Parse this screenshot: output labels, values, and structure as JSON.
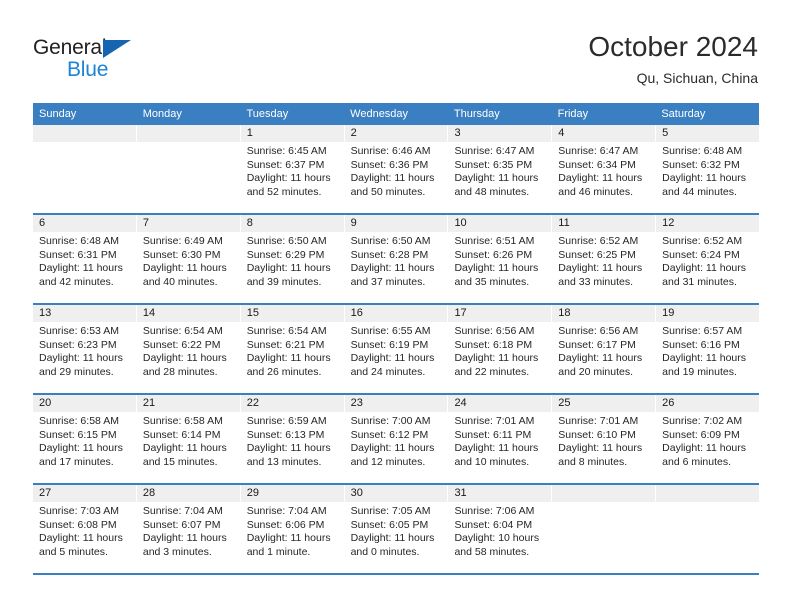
{
  "brand": {
    "name_top": "General",
    "name_bottom": "Blue",
    "triangle_color": "#1565b0",
    "blue_color": "#1b84d6"
  },
  "header": {
    "title": "October 2024",
    "subtitle": "Qu, Sichuan, China"
  },
  "theme": {
    "header_blue": "#3a7fc1",
    "day_number_bg": "#efefef"
  },
  "weekdays": [
    "Sunday",
    "Monday",
    "Tuesday",
    "Wednesday",
    "Thursday",
    "Friday",
    "Saturday"
  ],
  "weeks": [
    [
      {
        "day": "",
        "sunrise": "",
        "sunset": "",
        "daylight_line1": "",
        "daylight_line2": ""
      },
      {
        "day": "",
        "sunrise": "",
        "sunset": "",
        "daylight_line1": "",
        "daylight_line2": ""
      },
      {
        "day": "1",
        "sunrise": "Sunrise: 6:45 AM",
        "sunset": "Sunset: 6:37 PM",
        "daylight_line1": "Daylight: 11 hours",
        "daylight_line2": "and 52 minutes."
      },
      {
        "day": "2",
        "sunrise": "Sunrise: 6:46 AM",
        "sunset": "Sunset: 6:36 PM",
        "daylight_line1": "Daylight: 11 hours",
        "daylight_line2": "and 50 minutes."
      },
      {
        "day": "3",
        "sunrise": "Sunrise: 6:47 AM",
        "sunset": "Sunset: 6:35 PM",
        "daylight_line1": "Daylight: 11 hours",
        "daylight_line2": "and 48 minutes."
      },
      {
        "day": "4",
        "sunrise": "Sunrise: 6:47 AM",
        "sunset": "Sunset: 6:34 PM",
        "daylight_line1": "Daylight: 11 hours",
        "daylight_line2": "and 46 minutes."
      },
      {
        "day": "5",
        "sunrise": "Sunrise: 6:48 AM",
        "sunset": "Sunset: 6:32 PM",
        "daylight_line1": "Daylight: 11 hours",
        "daylight_line2": "and 44 minutes."
      }
    ],
    [
      {
        "day": "6",
        "sunrise": "Sunrise: 6:48 AM",
        "sunset": "Sunset: 6:31 PM",
        "daylight_line1": "Daylight: 11 hours",
        "daylight_line2": "and 42 minutes."
      },
      {
        "day": "7",
        "sunrise": "Sunrise: 6:49 AM",
        "sunset": "Sunset: 6:30 PM",
        "daylight_line1": "Daylight: 11 hours",
        "daylight_line2": "and 40 minutes."
      },
      {
        "day": "8",
        "sunrise": "Sunrise: 6:50 AM",
        "sunset": "Sunset: 6:29 PM",
        "daylight_line1": "Daylight: 11 hours",
        "daylight_line2": "and 39 minutes."
      },
      {
        "day": "9",
        "sunrise": "Sunrise: 6:50 AM",
        "sunset": "Sunset: 6:28 PM",
        "daylight_line1": "Daylight: 11 hours",
        "daylight_line2": "and 37 minutes."
      },
      {
        "day": "10",
        "sunrise": "Sunrise: 6:51 AM",
        "sunset": "Sunset: 6:26 PM",
        "daylight_line1": "Daylight: 11 hours",
        "daylight_line2": "and 35 minutes."
      },
      {
        "day": "11",
        "sunrise": "Sunrise: 6:52 AM",
        "sunset": "Sunset: 6:25 PM",
        "daylight_line1": "Daylight: 11 hours",
        "daylight_line2": "and 33 minutes."
      },
      {
        "day": "12",
        "sunrise": "Sunrise: 6:52 AM",
        "sunset": "Sunset: 6:24 PM",
        "daylight_line1": "Daylight: 11 hours",
        "daylight_line2": "and 31 minutes."
      }
    ],
    [
      {
        "day": "13",
        "sunrise": "Sunrise: 6:53 AM",
        "sunset": "Sunset: 6:23 PM",
        "daylight_line1": "Daylight: 11 hours",
        "daylight_line2": "and 29 minutes."
      },
      {
        "day": "14",
        "sunrise": "Sunrise: 6:54 AM",
        "sunset": "Sunset: 6:22 PM",
        "daylight_line1": "Daylight: 11 hours",
        "daylight_line2": "and 28 minutes."
      },
      {
        "day": "15",
        "sunrise": "Sunrise: 6:54 AM",
        "sunset": "Sunset: 6:21 PM",
        "daylight_line1": "Daylight: 11 hours",
        "daylight_line2": "and 26 minutes."
      },
      {
        "day": "16",
        "sunrise": "Sunrise: 6:55 AM",
        "sunset": "Sunset: 6:19 PM",
        "daylight_line1": "Daylight: 11 hours",
        "daylight_line2": "and 24 minutes."
      },
      {
        "day": "17",
        "sunrise": "Sunrise: 6:56 AM",
        "sunset": "Sunset: 6:18 PM",
        "daylight_line1": "Daylight: 11 hours",
        "daylight_line2": "and 22 minutes."
      },
      {
        "day": "18",
        "sunrise": "Sunrise: 6:56 AM",
        "sunset": "Sunset: 6:17 PM",
        "daylight_line1": "Daylight: 11 hours",
        "daylight_line2": "and 20 minutes."
      },
      {
        "day": "19",
        "sunrise": "Sunrise: 6:57 AM",
        "sunset": "Sunset: 6:16 PM",
        "daylight_line1": "Daylight: 11 hours",
        "daylight_line2": "and 19 minutes."
      }
    ],
    [
      {
        "day": "20",
        "sunrise": "Sunrise: 6:58 AM",
        "sunset": "Sunset: 6:15 PM",
        "daylight_line1": "Daylight: 11 hours",
        "daylight_line2": "and 17 minutes."
      },
      {
        "day": "21",
        "sunrise": "Sunrise: 6:58 AM",
        "sunset": "Sunset: 6:14 PM",
        "daylight_line1": "Daylight: 11 hours",
        "daylight_line2": "and 15 minutes."
      },
      {
        "day": "22",
        "sunrise": "Sunrise: 6:59 AM",
        "sunset": "Sunset: 6:13 PM",
        "daylight_line1": "Daylight: 11 hours",
        "daylight_line2": "and 13 minutes."
      },
      {
        "day": "23",
        "sunrise": "Sunrise: 7:00 AM",
        "sunset": "Sunset: 6:12 PM",
        "daylight_line1": "Daylight: 11 hours",
        "daylight_line2": "and 12 minutes."
      },
      {
        "day": "24",
        "sunrise": "Sunrise: 7:01 AM",
        "sunset": "Sunset: 6:11 PM",
        "daylight_line1": "Daylight: 11 hours",
        "daylight_line2": "and 10 minutes."
      },
      {
        "day": "25",
        "sunrise": "Sunrise: 7:01 AM",
        "sunset": "Sunset: 6:10 PM",
        "daylight_line1": "Daylight: 11 hours",
        "daylight_line2": "and 8 minutes."
      },
      {
        "day": "26",
        "sunrise": "Sunrise: 7:02 AM",
        "sunset": "Sunset: 6:09 PM",
        "daylight_line1": "Daylight: 11 hours",
        "daylight_line2": "and 6 minutes."
      }
    ],
    [
      {
        "day": "27",
        "sunrise": "Sunrise: 7:03 AM",
        "sunset": "Sunset: 6:08 PM",
        "daylight_line1": "Daylight: 11 hours",
        "daylight_line2": "and 5 minutes."
      },
      {
        "day": "28",
        "sunrise": "Sunrise: 7:04 AM",
        "sunset": "Sunset: 6:07 PM",
        "daylight_line1": "Daylight: 11 hours",
        "daylight_line2": "and 3 minutes."
      },
      {
        "day": "29",
        "sunrise": "Sunrise: 7:04 AM",
        "sunset": "Sunset: 6:06 PM",
        "daylight_line1": "Daylight: 11 hours",
        "daylight_line2": "and 1 minute."
      },
      {
        "day": "30",
        "sunrise": "Sunrise: 7:05 AM",
        "sunset": "Sunset: 6:05 PM",
        "daylight_line1": "Daylight: 11 hours",
        "daylight_line2": "and 0 minutes."
      },
      {
        "day": "31",
        "sunrise": "Sunrise: 7:06 AM",
        "sunset": "Sunset: 6:04 PM",
        "daylight_line1": "Daylight: 10 hours",
        "daylight_line2": "and 58 minutes."
      },
      {
        "day": "",
        "sunrise": "",
        "sunset": "",
        "daylight_line1": "",
        "daylight_line2": ""
      },
      {
        "day": "",
        "sunrise": "",
        "sunset": "",
        "daylight_line1": "",
        "daylight_line2": ""
      }
    ]
  ]
}
